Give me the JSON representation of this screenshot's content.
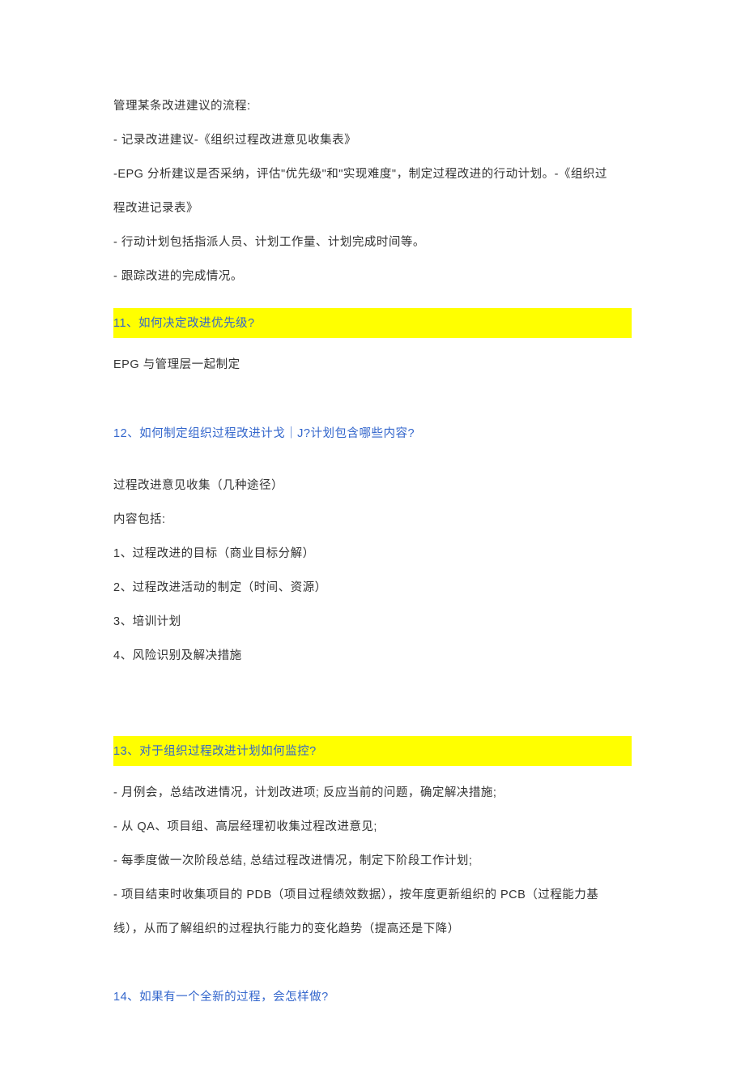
{
  "heading_process": "管理某条改进建议的流程:",
  "process_step1": "-  记录改进建议-《组织过程改进意见收集表》",
  "process_step2a": "-EPG 分析建议是否采纳，评估\"优先级\"和\"实现难度\"，制定过程改进的行动计划。-《组织过",
  "process_step2b": "程改进记录表》",
  "process_step3": "-  行动计划包括指派人员、计划工作量、计划完成时间等。",
  "process_step4": "-  跟踪改进的完成情况。",
  "q11": "11、如何决定改进优先级?",
  "a11": "EPG 与管理层一起制定",
  "q12": "12、如何制定组织过程改进计戈｜J?计划包含哪些内容?",
  "a12_intro1": "过程改进意见收集（几种途径）",
  "a12_intro2": "内容包括:",
  "a12_item1": "1、过程改进的目标（商业目标分解）",
  "a12_item2": "2、过程改进活动的制定（时间、资源）",
  "a12_item3": "3、培训计划",
  "a12_item4": "4、风险识别及解决措施",
  "q13": "13、对于组织过程改进计划如何监控?",
  "a13_item1": "-  月例会，总结改进情况，计划改进项; 反应当前的问题，确定解决措施;",
  "a13_item2": "-  从 QA、项目组、高层经理初收集过程改进意见;",
  "a13_item3": "-  每季度做一次阶段总结, 总结过程改进情况，制定下阶段工作计划;",
  "a13_item4a": "-  项目结束时收集项目的 PDB（项目过程绩效数据），按年度更新组织的 PCB（过程能力基",
  "a13_item4b": "线），从而了解组织的过程执行能力的变化趋势（提高还是下降）",
  "q14": "14、如果有一个全新的过程，会怎样做?"
}
